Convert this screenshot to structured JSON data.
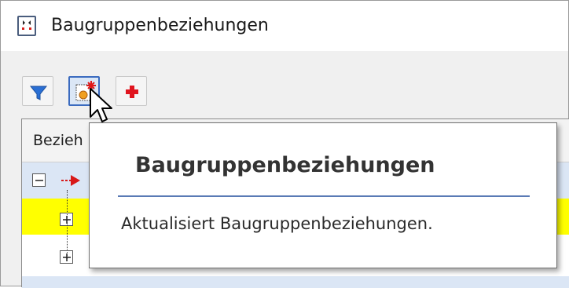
{
  "window": {
    "title": "Baugruppenbeziehungen",
    "app_icon": "assembly-relations-icon"
  },
  "toolbar": {
    "buttons": [
      {
        "icon": "filter-icon",
        "state": "normal"
      },
      {
        "icon": "refresh-relations-icon",
        "state": "hovered"
      },
      {
        "icon": "add-icon",
        "state": "normal"
      }
    ]
  },
  "grid": {
    "column_header": "Bezieh",
    "rows": [
      {
        "expander": "collapse",
        "icon": "red-arrow-icon",
        "highlight": "#dbe6f5"
      },
      {
        "expander": "expand",
        "highlight": "#ffff00"
      },
      {
        "expander": "expand",
        "highlight": "#ffffff"
      }
    ]
  },
  "tooltip": {
    "title": "Baugruppenbeziehungen",
    "body": "Aktualisiert Baugruppenbeziehungen.",
    "rule_color": "#5a7ab5"
  },
  "colors": {
    "accent": "#3b6bbf",
    "highlight_yellow": "#ffff00",
    "selection_blue": "#dbe6f5",
    "add_red": "#e0141e"
  }
}
